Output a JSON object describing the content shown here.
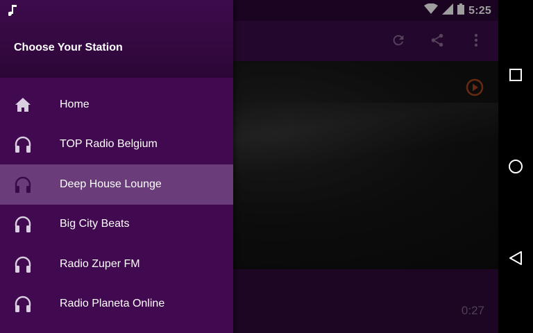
{
  "status_bar": {
    "time": "5:25",
    "icons": [
      "music-note-icon",
      "wifi-icon",
      "signal-icon",
      "battery-icon"
    ]
  },
  "toolbar": {
    "actions": [
      "refresh-icon",
      "share-icon",
      "more-vert-icon"
    ]
  },
  "drawer": {
    "title": "Choose Your Station",
    "items": [
      {
        "label": "Home",
        "icon": "home-icon",
        "active": false
      },
      {
        "label": "TOP Radio Belgium",
        "icon": "headphones-icon",
        "active": false
      },
      {
        "label": "Deep House Lounge",
        "icon": "headphones-icon",
        "active": true
      },
      {
        "label": "Big City Beats",
        "icon": "headphones-icon",
        "active": false
      },
      {
        "label": "Radio Zuper FM",
        "icon": "headphones-icon",
        "active": false
      },
      {
        "label": "Radio Planeta Online",
        "icon": "headphones-icon",
        "active": false
      }
    ]
  },
  "player": {
    "elapsed": "0:27"
  },
  "colors": {
    "drawer_bg": "#41094f",
    "drawer_active": "#6a3d7a",
    "accent_play": "#c0531f"
  },
  "nav_bar": {
    "buttons": [
      "recents-icon",
      "home-circle-icon",
      "back-icon"
    ]
  }
}
